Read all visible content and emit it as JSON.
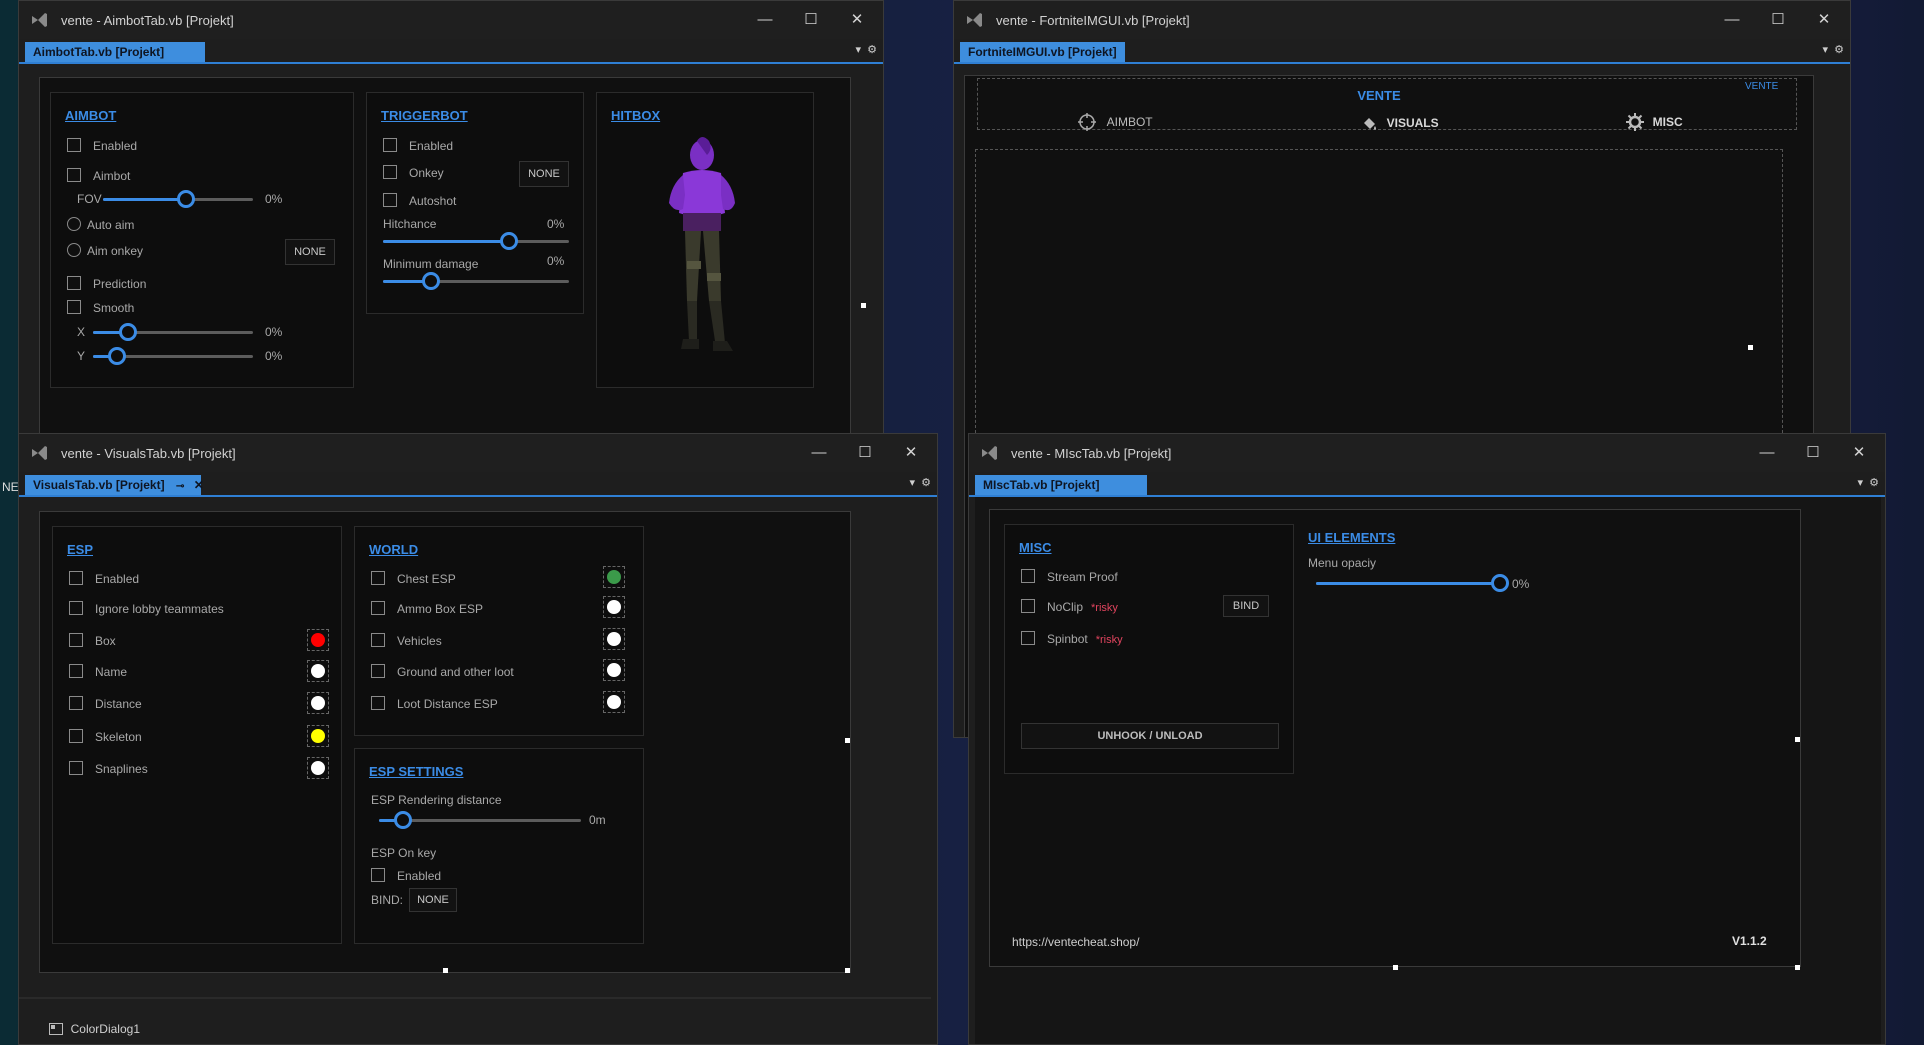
{
  "colors": {
    "accent": "#3b8ce6",
    "tab_blue": "#3e8ede",
    "risky": "#e0445e",
    "window_bg": "#1e1e1e",
    "panel_bg": "#0d0d0d"
  },
  "edge_text": {
    "left": "NE"
  },
  "aimbot_window": {
    "title": "vente - AimbotTab.vb [Projekt]",
    "doc_tab": "AimbotTab.vb [Projekt]",
    "aimbot": {
      "header": "AIMBOT",
      "enabled": "Enabled",
      "aimbot": "Aimbot",
      "fov": {
        "label": "FOV",
        "value": 0.55,
        "pct": "0%"
      },
      "auto_aim": "Auto aim",
      "aim_onkey": "Aim onkey",
      "aim_onkey_key": "NONE",
      "prediction": "Prediction",
      "smooth": "Smooth",
      "x": {
        "label": "X",
        "value": 0.22,
        "pct": "0%"
      },
      "y": {
        "label": "Y",
        "value": 0.15,
        "pct": "0%"
      }
    },
    "triggerbot": {
      "header": "TRIGGERBOT",
      "enabled": "Enabled",
      "onkey": "Onkey",
      "onkey_key": "NONE",
      "autoshot": "Autoshot",
      "hitchance": {
        "label": "Hitchance",
        "value": 0.68,
        "pct": "0%"
      },
      "min_damage": {
        "label": "Minimum damage",
        "value": 0.26,
        "pct": "0%"
      }
    },
    "hitbox": {
      "header": "HITBOX"
    }
  },
  "fortnite_window": {
    "title": "vente - FortniteIMGUI.vb [Projekt]",
    "doc_tab": "FortniteIMGUI.vb [Projekt]",
    "brand": "VENTE",
    "brand_corner": "VENTE",
    "tabs": [
      "AIMBOT",
      "VISUALS",
      "MISC"
    ]
  },
  "visuals_window": {
    "title": "vente - VisualsTab.vb [Projekt]",
    "doc_tab": "VisualsTab.vb [Projekt]",
    "esp": {
      "header": "ESP",
      "items": [
        {
          "label": "Enabled"
        },
        {
          "label": "Ignore lobby teammates"
        },
        {
          "label": "Box",
          "color": "#ff0000"
        },
        {
          "label": "Name",
          "color": "#ffffff"
        },
        {
          "label": "Distance",
          "color": "#ffffff"
        },
        {
          "label": "Skeleton",
          "color": "#ffff00"
        },
        {
          "label": "Snaplines",
          "color": "#ffffff"
        }
      ]
    },
    "world": {
      "header": "WORLD",
      "items": [
        {
          "label": "Chest ESP",
          "color": "#3b9a4a"
        },
        {
          "label": "Ammo Box ESP",
          "color": "#ffffff"
        },
        {
          "label": "Vehicles",
          "color": "#ffffff"
        },
        {
          "label": "Ground and other loot",
          "color": "#ffffff"
        },
        {
          "label": "Loot Distance ESP",
          "color": "#ffffff"
        }
      ]
    },
    "esp_settings": {
      "header": "ESP SETTINGS",
      "render_distance": {
        "label": "ESP Rendering distance",
        "value": 0.12,
        "unit_text": "0m"
      },
      "on_key_label": "ESP On key",
      "enabled": "Enabled",
      "bind_label": "BIND:",
      "bind_key": "NONE"
    },
    "component_tray": "ColorDialog1"
  },
  "misc_window": {
    "title": "vente - MIscTab.vb [Projekt]",
    "doc_tab": "MIscTab.vb [Projekt]",
    "misc": {
      "header": "MISC",
      "stream_proof": "Stream Proof",
      "noclip": "NoClip",
      "noclip_tag": "*risky",
      "noclip_bind": "BIND",
      "spinbot": "Spinbot",
      "spinbot_tag": "*risky",
      "unhook": "UNHOOK / UNLOAD"
    },
    "ui_elements": {
      "header": "UI ELEMENTS",
      "menu_opacity": {
        "label": "Menu opaciy",
        "value": 1.0,
        "pct": "0%"
      }
    },
    "url": "https://ventecheat.shop/",
    "version": "V1.1.2"
  }
}
